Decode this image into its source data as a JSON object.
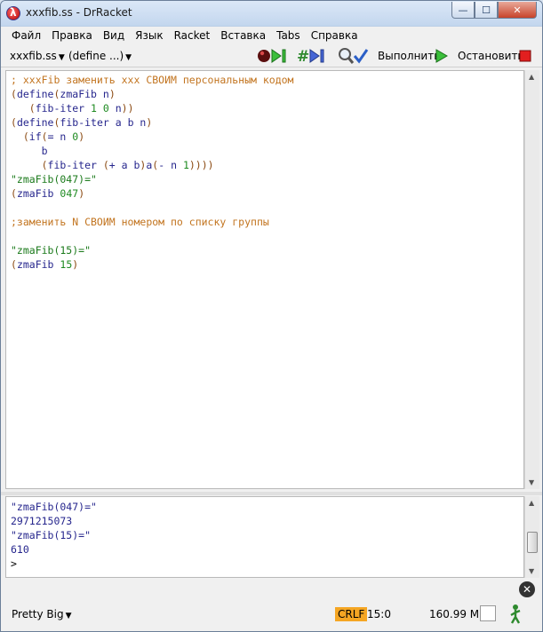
{
  "window": {
    "title": "xxxfib.ss - DrRacket",
    "minimize_glyph": "—",
    "maximize_glyph": "☐",
    "close_glyph": "✕"
  },
  "menu": [
    "Файл",
    "Правка",
    "Вид",
    "Язык",
    "Racket",
    "Вставка",
    "Tabs",
    "Справка"
  ],
  "toolbar": {
    "file_menu": "xxxfib.ss",
    "define_menu": "(define ...)",
    "run_label": "Выполнить",
    "stop_label": "Остановить",
    "icons": [
      "debug-icon",
      "macro-stepper-icon",
      "check-syntax-icon",
      "run-icon",
      "stop-icon"
    ]
  },
  "definitions": [
    [
      {
        "t": "; xxxFib заменить xxx СВОИМ персональным кодом",
        "c": "c-comment"
      }
    ],
    [
      {
        "t": "(",
        "c": "c-paren"
      },
      {
        "t": "define",
        "c": "c-ident"
      },
      {
        "t": "(",
        "c": "c-paren"
      },
      {
        "t": "zmaFib n",
        "c": "c-ident"
      },
      {
        "t": ")",
        "c": "c-paren"
      }
    ],
    [
      {
        "t": "   (",
        "c": "c-paren"
      },
      {
        "t": "fib-iter ",
        "c": "c-ident"
      },
      {
        "t": "1 0",
        "c": "c-num"
      },
      {
        "t": " n",
        "c": "c-ident"
      },
      {
        "t": "))",
        "c": "c-paren"
      }
    ],
    [
      {
        "t": "(",
        "c": "c-paren"
      },
      {
        "t": "define",
        "c": "c-ident"
      },
      {
        "t": "(",
        "c": "c-paren"
      },
      {
        "t": "fib-iter a b n",
        "c": "c-ident"
      },
      {
        "t": ")",
        "c": "c-paren"
      }
    ],
    [
      {
        "t": "  (",
        "c": "c-paren"
      },
      {
        "t": "if",
        "c": "c-ident"
      },
      {
        "t": "(",
        "c": "c-paren"
      },
      {
        "t": "= n ",
        "c": "c-ident"
      },
      {
        "t": "0",
        "c": "c-num"
      },
      {
        "t": ")",
        "c": "c-paren"
      }
    ],
    [
      {
        "t": "     b",
        "c": "c-ident"
      }
    ],
    [
      {
        "t": "     (",
        "c": "c-paren"
      },
      {
        "t": "fib-iter ",
        "c": "c-ident"
      },
      {
        "t": "(",
        "c": "c-paren"
      },
      {
        "t": "+ a b",
        "c": "c-ident"
      },
      {
        "t": ")",
        "c": "c-paren"
      },
      {
        "t": "a",
        "c": "c-ident"
      },
      {
        "t": "(",
        "c": "c-paren"
      },
      {
        "t": "- n ",
        "c": "c-ident"
      },
      {
        "t": "1",
        "c": "c-num"
      },
      {
        "t": "))))",
        "c": "c-paren"
      }
    ],
    [
      {
        "t": "\"zmaFib(047)=\"",
        "c": "c-str"
      }
    ],
    [
      {
        "t": "(",
        "c": "c-paren"
      },
      {
        "t": "zmaFib ",
        "c": "c-ident"
      },
      {
        "t": "047",
        "c": "c-num"
      },
      {
        "t": ")",
        "c": "c-paren"
      }
    ],
    [],
    [
      {
        "t": ";заменить N СВОИМ номером по списку группы",
        "c": "c-comment"
      }
    ],
    [],
    [
      {
        "t": "\"zmaFib(15)=\"",
        "c": "c-str"
      }
    ],
    [
      {
        "t": "(",
        "c": "c-paren"
      },
      {
        "t": "zmaFib ",
        "c": "c-ident"
      },
      {
        "t": "15",
        "c": "c-num"
      },
      {
        "t": ")",
        "c": "c-paren"
      }
    ]
  ],
  "interactions": [
    {
      "t": "\"zmaFib(047)=\"",
      "c": "o-val"
    },
    {
      "t": "2971215073",
      "c": "o-val"
    },
    {
      "t": "\"zmaFib(15)=\"",
      "c": "o-val"
    },
    {
      "t": "610",
      "c": "o-val"
    },
    {
      "t": ">",
      "c": "o-prompt"
    }
  ],
  "status": {
    "language": "Pretty Big",
    "line_ending": "CRLF",
    "position": "15:0",
    "memory": "160.99 MB"
  },
  "colors": {
    "comment": "#c2741f",
    "paren": "#8b4a12",
    "identifier": "#26268d",
    "number": "#1d8a20",
    "string": "#1b7a1b",
    "crlf_badge": "#f5a623"
  }
}
